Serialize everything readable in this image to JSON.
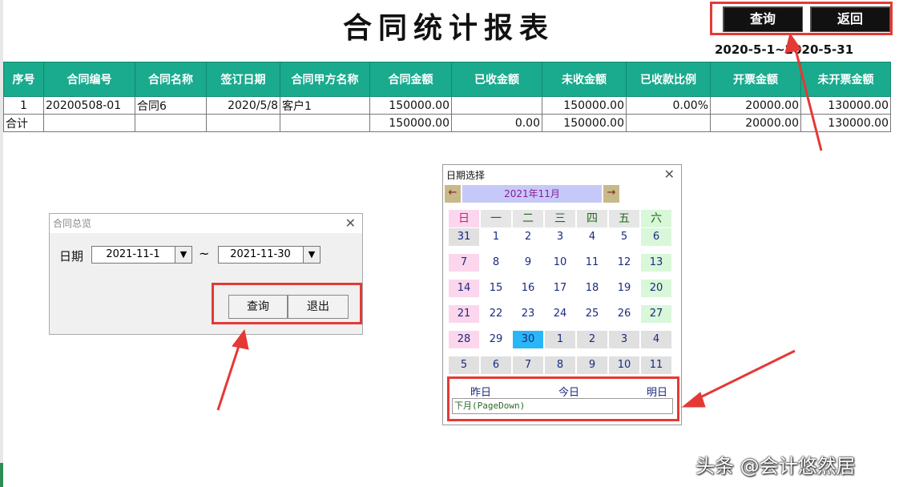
{
  "report": {
    "title": "合同统计报表",
    "query_label": "查询",
    "back_label": "返回",
    "date_range": "2020-5-1~2020-5-31"
  },
  "table": {
    "headers": [
      "序号",
      "合同编号",
      "合同名称",
      "签订日期",
      "合同甲方名称",
      "合同金额",
      "已收金额",
      "未收金额",
      "已收款比例",
      "开票金额",
      "未开票金额"
    ],
    "rows": [
      [
        "1",
        "20200508-01",
        "合同6",
        "2020/5/8",
        "客户1",
        "150000.00",
        "",
        "150000.00",
        "0.00%",
        "20000.00",
        "130000.00"
      ],
      [
        "合计",
        "",
        "",
        "",
        "",
        "150000.00",
        "0.00",
        "150000.00",
        "",
        "20000.00",
        "130000.00"
      ]
    ]
  },
  "overview_dialog": {
    "title": "合同总览",
    "date_label": "日期",
    "start_date": "2021-11-1",
    "tilde": "~",
    "end_date": "2021-11-30",
    "query_label": "查询",
    "exit_label": "退出"
  },
  "calendar": {
    "title": "日期选择",
    "month_label": "2021年11月",
    "prev_arrow": "←",
    "next_arrow": "→",
    "weekdays": [
      "日",
      "一",
      "二",
      "三",
      "四",
      "五",
      "六"
    ],
    "days": [
      "31",
      "1",
      "2",
      "3",
      "4",
      "5",
      "6",
      "7",
      "8",
      "9",
      "10",
      "11",
      "12",
      "13",
      "14",
      "15",
      "16",
      "17",
      "18",
      "19",
      "20",
      "21",
      "22",
      "23",
      "24",
      "25",
      "26",
      "27",
      "28",
      "29",
      "30",
      "1",
      "2",
      "3",
      "4",
      "5",
      "6",
      "7",
      "8",
      "9",
      "10",
      "11"
    ],
    "selected_day": "30",
    "yesterday_label": "昨日",
    "today_label": "今日",
    "tomorrow_label": "明日",
    "hint": "下月(PageDown)"
  },
  "watermark": "头条 @会计悠然居",
  "colors": {
    "header_teal": "#1aaa8d",
    "highlight_red": "#e53935",
    "month_bar": "#c6c9f8",
    "selected_day": "#29b6f6"
  }
}
